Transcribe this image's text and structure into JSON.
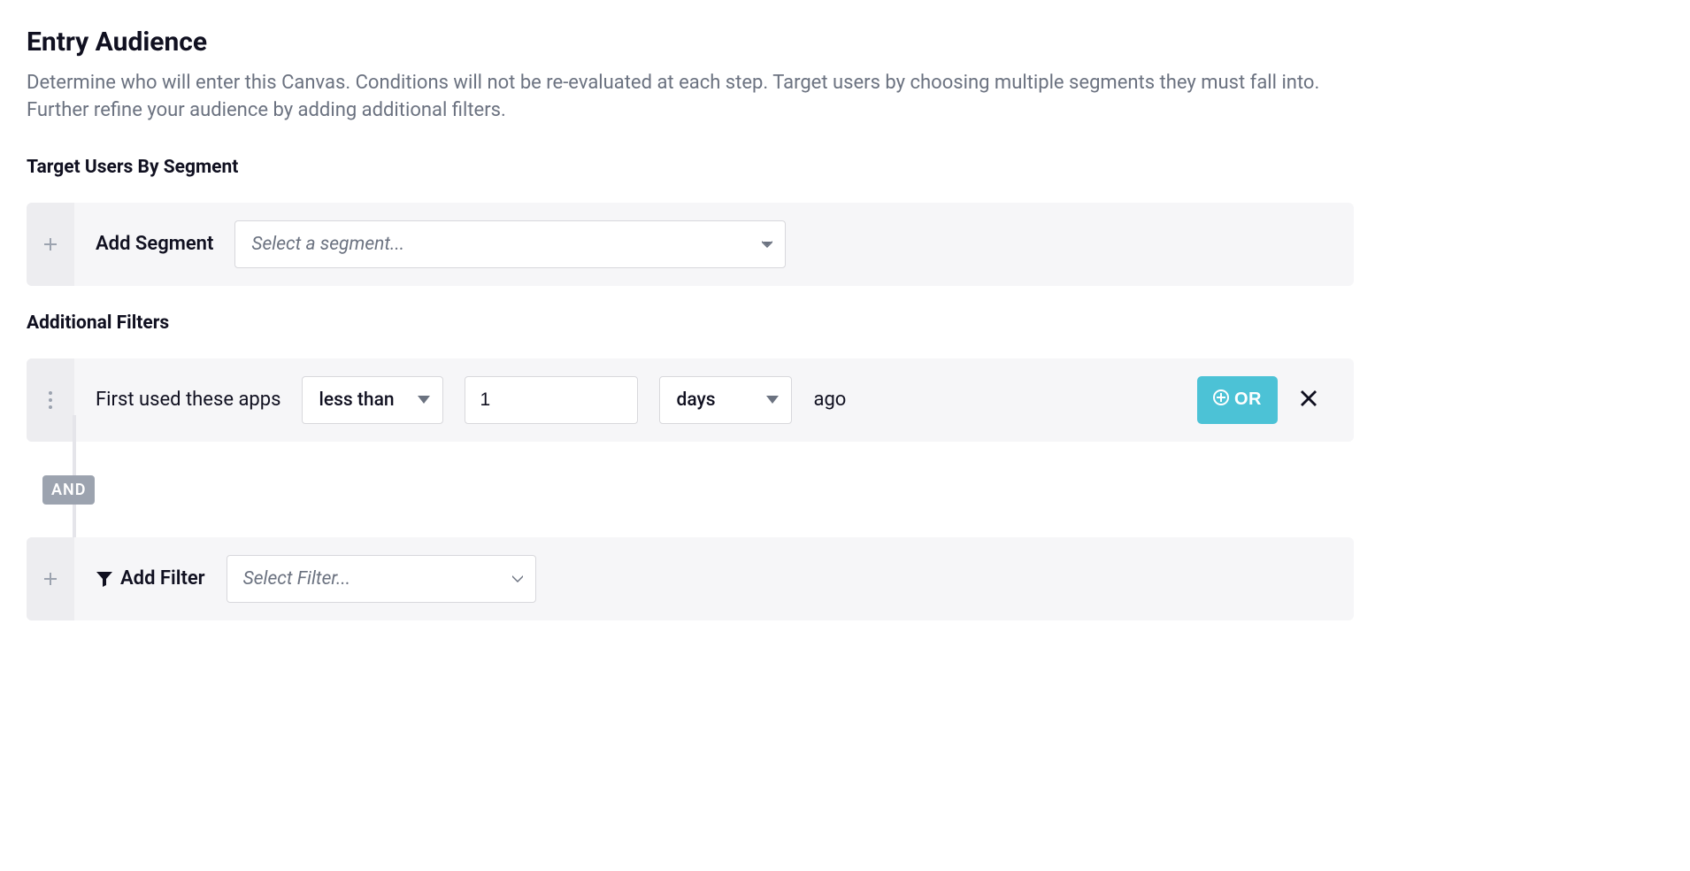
{
  "header": {
    "title": "Entry Audience",
    "description": "Determine who will enter this Canvas. Conditions will not be re-evaluated at each step. Target users by choosing multiple segments they must fall into. Further refine your audience by adding additional filters."
  },
  "segments": {
    "section_title": "Target Users By Segment",
    "add_label": "Add Segment",
    "select_placeholder": "Select a segment..."
  },
  "filters": {
    "section_title": "Additional Filters",
    "connector_label": "AND",
    "row": {
      "field_label": "First used these apps",
      "operator": "less than",
      "value": "1",
      "unit": "days",
      "suffix": "ago",
      "or_label": "OR"
    },
    "add": {
      "label": "Add Filter",
      "select_placeholder": "Select Filter..."
    }
  }
}
